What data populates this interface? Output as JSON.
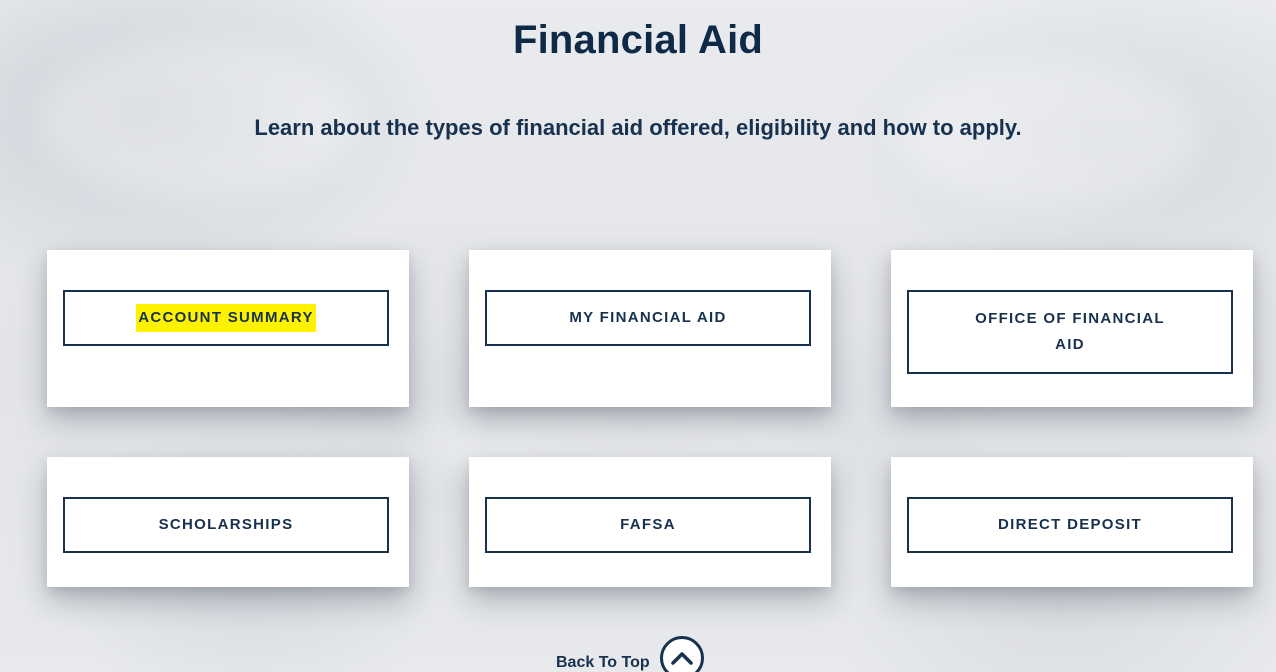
{
  "page": {
    "title": "Financial Aid",
    "subtitle": "Learn about the types of financial aid offered, eligibility and how to apply."
  },
  "cards": [
    {
      "label": "ACCOUNT SUMMARY",
      "highlighted": true
    },
    {
      "label": "MY FINANCIAL AID"
    },
    {
      "label": "OFFICE OF FINANCIAL AID"
    },
    {
      "label": "SCHOLARSHIPS"
    },
    {
      "label": "FAFSA"
    },
    {
      "label": "DIRECT DEPOSIT"
    }
  ],
  "footer": {
    "back_to_top": "Back To Top",
    "back_to_top_icon": "chevron-up-circle-icon"
  },
  "colors": {
    "primary": "#17314f",
    "highlight": "#fff200",
    "card_bg": "#ffffff"
  }
}
